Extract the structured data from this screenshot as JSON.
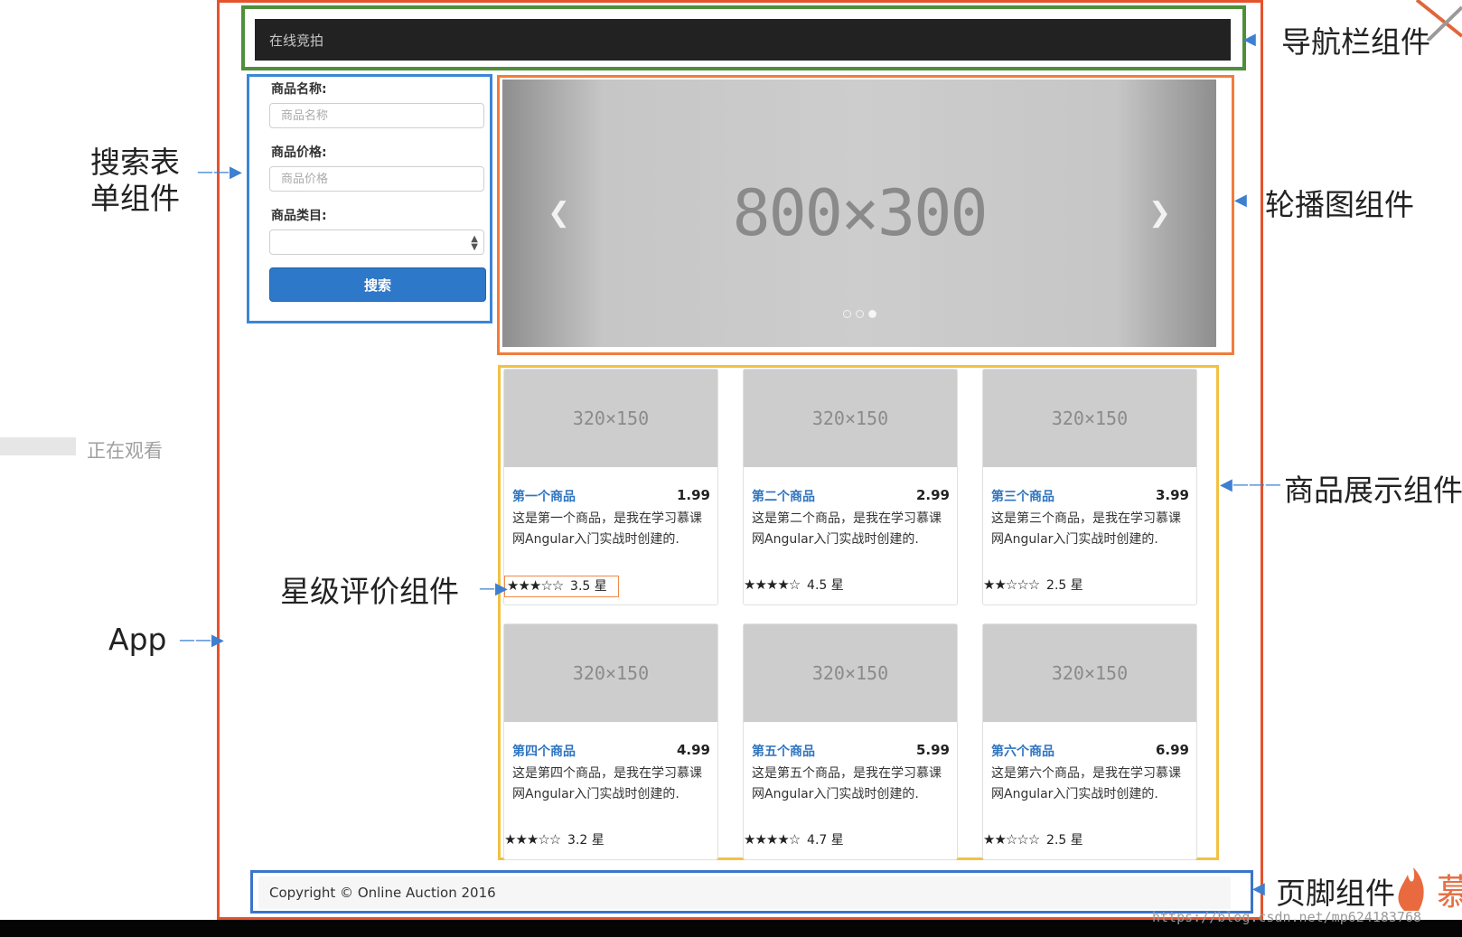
{
  "navbar": {
    "title": "在线竞拍"
  },
  "search": {
    "name_label": "商品名称:",
    "name_placeholder": "商品名称",
    "price_label": "商品价格:",
    "price_placeholder": "商品价格",
    "category_label": "商品类目:",
    "category_value": "",
    "submit_label": "搜索"
  },
  "carousel": {
    "placeholder": "800×300",
    "slide_count": 3,
    "active_index": 2
  },
  "products": [
    {
      "image": "320×150",
      "title": "第一个商品",
      "price": "1.99",
      "description": "这是第一个商品，是我在学习慕课网Angular入门实战时创建的.",
      "stars": "★★★☆☆",
      "rating_text": "3.5 星",
      "rating": 3.5
    },
    {
      "image": "320×150",
      "title": "第二个商品",
      "price": "2.99",
      "description": "这是第二个商品，是我在学习慕课网Angular入门实战时创建的.",
      "stars": "★★★★☆",
      "rating_text": "4.5 星",
      "rating": 4.5
    },
    {
      "image": "320×150",
      "title": "第三个商品",
      "price": "3.99",
      "description": "这是第三个商品，是我在学习慕课网Angular入门实战时创建的.",
      "stars": "★★☆☆☆",
      "rating_text": "2.5 星",
      "rating": 2.5
    },
    {
      "image": "320×150",
      "title": "第四个商品",
      "price": "4.99",
      "description": "这是第四个商品，是我在学习慕课网Angular入门实战时创建的.",
      "stars": "★★★☆☆",
      "rating_text": "3.2 星",
      "rating": 3.2
    },
    {
      "image": "320×150",
      "title": "第五个商品",
      "price": "5.99",
      "description": "这是第五个商品，是我在学习慕课网Angular入门实战时创建的.",
      "stars": "★★★★☆",
      "rating_text": "4.7 星",
      "rating": 4.7
    },
    {
      "image": "320×150",
      "title": "第六个商品",
      "price": "6.99",
      "description": "这是第六个商品，是我在学习慕课网Angular入门实战时创建的.",
      "stars": "★★☆☆☆",
      "rating_text": "2.5 星",
      "rating": 2.5
    }
  ],
  "footer": {
    "copyright": "Copyright © Online Auction 2016"
  },
  "annotations": {
    "navbar": "导航栏组件",
    "search_line1": "搜索表",
    "search_line2": "单组件",
    "carousel": "轮播图组件",
    "products": "商品展示组件",
    "stars": "星级评价组件",
    "app": "App",
    "footer": "页脚组件"
  },
  "overlay": {
    "watching": "正在观看",
    "watermark": "https://blog.csdn.net/mp624183768",
    "brand_char": "慕"
  },
  "colors": {
    "app_frame": "#e5532d",
    "nav_frame": "#4f8f3a",
    "search_frame": "#3b86d6",
    "carousel_frame": "#f07d3a",
    "products_frame": "#f2c143",
    "footer_frame": "#3b74c9",
    "primary_button": "#2e78c9",
    "link": "#2f74c0"
  }
}
